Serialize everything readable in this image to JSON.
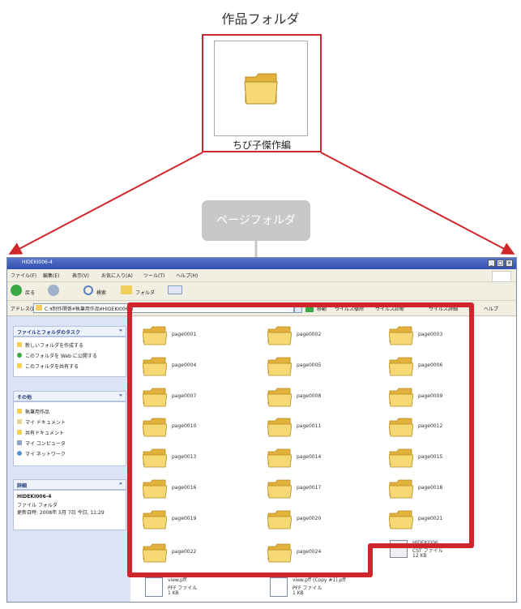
{
  "top": {
    "title": "作品フォルダ",
    "folder_caption": "ちび子傑作編"
  },
  "callout": {
    "text": "ページフォルダ"
  },
  "window": {
    "title": "HIDEKI006-4",
    "menu": [
      "ファイル(F)",
      "編集(E)",
      "表示(V)",
      "お気に入り(A)",
      "ツール(T)",
      "ヘルプ(H)"
    ],
    "toolbar": [
      "戻る",
      "検索",
      "フォルダ"
    ],
    "address_label": "アドレス(D)",
    "address_path": "C:¥制作関係¥執筆用作品¥HIDEKI006-4",
    "address_extra": [
      "移動",
      "ウイルス駆除",
      "ウイルス診断",
      "ウイルス詳細",
      "ヘルプ"
    ],
    "tasks_panel": {
      "title": "ファイルとフォルダのタスク",
      "items": [
        "新しいフォルダを作成する",
        "このフォルダを Web に公開する",
        "このフォルダを共有する"
      ]
    },
    "other_panel": {
      "title": "その他",
      "items": [
        "執筆用作品",
        "マイ ドキュメント",
        "共有ドキュメント",
        "マイ コンピュータ",
        "マイ ネットワーク"
      ]
    },
    "detail_panel": {
      "title": "詳細",
      "name": "HIDEKI006-4",
      "type": "ファイル フォルダ",
      "date": "更新日時: 2008年 5月 7日 今日, 11:29"
    },
    "folders": [
      "page0001",
      "page0002",
      "page0003",
      "page0004",
      "page0005",
      "page0006",
      "page0007",
      "page0008",
      "page0009",
      "page0010",
      "page0011",
      "page0012",
      "page0013",
      "page0014",
      "page0015",
      "page0016",
      "page0017",
      "page0018",
      "page0019",
      "page0020",
      "page0021",
      "page0022",
      "page0024"
    ],
    "files": [
      {
        "name": "HIDEKI006",
        "type": "CST ファイル",
        "size": "12 KB"
      },
      {
        "name": "view.pff",
        "type": "PFF ファイル",
        "size": "1 KB"
      },
      {
        "name": "view.pff (Copy #1).pff",
        "type": "PFF ファイル",
        "size": "1 KB"
      }
    ]
  },
  "colors": {
    "highlight": "#d0262b",
    "callout": "#c8c8c8",
    "folder": "#f2cf5a",
    "titlebar": "#2f4fb0"
  }
}
